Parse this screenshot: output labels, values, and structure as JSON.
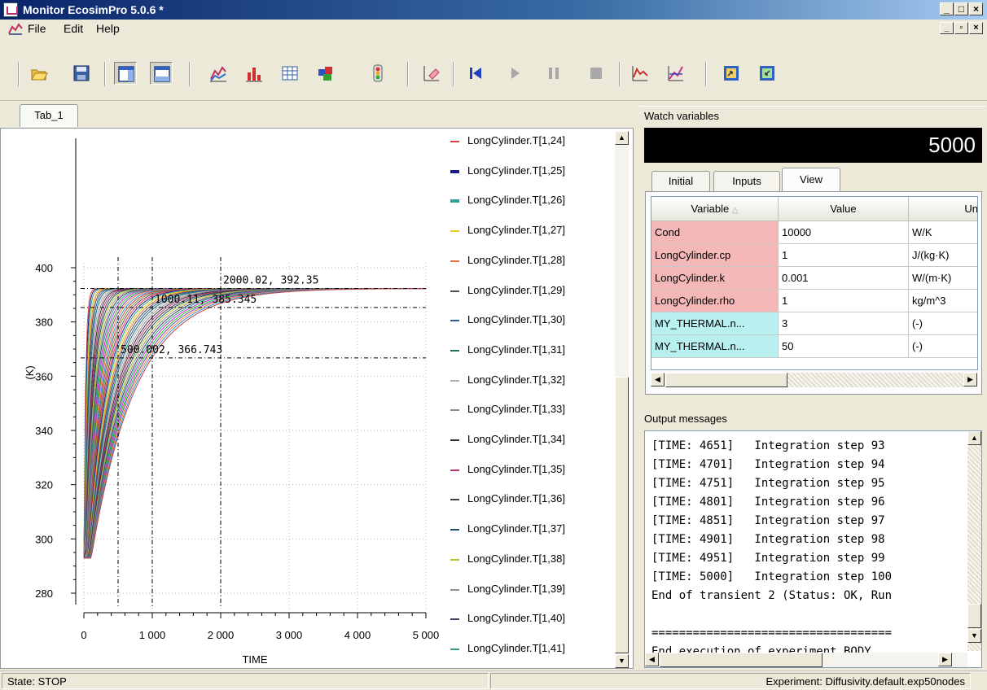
{
  "window": {
    "title": "Monitor EcosimPro 5.0.6 *"
  },
  "menu": {
    "items": [
      "File",
      "Edit",
      "Help"
    ]
  },
  "toolbar": {
    "buttons": [
      "open-folder",
      "save",
      "layout-vertical",
      "layout-horizontal",
      "line-plot",
      "bar-chart",
      "table-view",
      "color-tool",
      "traffic-light",
      "clear-plot",
      "go-to-start",
      "play",
      "pause",
      "stop",
      "plot-options",
      "plot-edit",
      "export-1",
      "export-2"
    ]
  },
  "plot": {
    "tab_label": "Tab_1",
    "y_axis_label": "(K)",
    "x_axis_label": "TIME",
    "y_ticks": [
      "400",
      "380",
      "360",
      "340",
      "320",
      "300",
      "280"
    ],
    "x_ticks": [
      "0",
      "1 000",
      "2 000",
      "3 000",
      "4 000",
      "5 000"
    ],
    "annotations": [
      "2000.02, 392.35",
      "1000.11, 385.345",
      "500.002, 366.743"
    ],
    "legend": [
      {
        "label": "LongCylinder.T[1,24]",
        "color": "#e04040"
      },
      {
        "label": "LongCylinder.T[1,25]",
        "color": "#1a1a8c"
      },
      {
        "label": "LongCylinder.T[1,26]",
        "color": "#2aa198"
      },
      {
        "label": "LongCylinder.T[1,27]",
        "color": "#e6d21e"
      },
      {
        "label": "LongCylinder.T[1,28]",
        "color": "#e8703a"
      },
      {
        "label": "LongCylinder.T[1,29]",
        "color": "#505050"
      },
      {
        "label": "LongCylinder.T[1,30]",
        "color": "#2060a0"
      },
      {
        "label": "LongCylinder.T[1,31]",
        "color": "#207060"
      },
      {
        "label": "LongCylinder.T[1,32]",
        "color": "#b0b0b0"
      },
      {
        "label": "LongCylinder.T[1,33]",
        "color": "#a080a0"
      },
      {
        "label": "LongCylinder.T[1,34]",
        "color": "#303030"
      },
      {
        "label": "LongCylinder.T[1,35]",
        "color": "#c0307a"
      },
      {
        "label": "LongCylinder.T[1,36]",
        "color": "#404040"
      },
      {
        "label": "LongCylinder.T[1,37]",
        "color": "#205070"
      },
      {
        "label": "LongCylinder.T[1,38]",
        "color": "#c0c020"
      },
      {
        "label": "LongCylinder.T[1,39]",
        "color": "#909090"
      },
      {
        "label": "LongCylinder.T[1,40]",
        "color": "#404060"
      },
      {
        "label": "LongCylinder.T[1,41]",
        "color": "#30a090"
      }
    ]
  },
  "chart_data": {
    "type": "line",
    "xlabel": "TIME",
    "ylabel": "(K)",
    "xlim": [
      0,
      5000
    ],
    "ylim": [
      280,
      400
    ],
    "annotations": [
      {
        "x": 2000.02,
        "y": 392.35,
        "text": "2000.02, 392.35"
      },
      {
        "x": 1000.11,
        "y": 385.345,
        "text": "1000.11, 385.345"
      },
      {
        "x": 500.002,
        "y": 366.743,
        "text": "500.002, 366.743"
      }
    ],
    "series_visible_in_legend": [
      "LongCylinder.T[1,24]",
      "LongCylinder.T[1,25]",
      "LongCylinder.T[1,26]",
      "LongCylinder.T[1,27]",
      "LongCylinder.T[1,28]",
      "LongCylinder.T[1,29]",
      "LongCylinder.T[1,30]",
      "LongCylinder.T[1,31]",
      "LongCylinder.T[1,32]",
      "LongCylinder.T[1,33]",
      "LongCylinder.T[1,34]",
      "LongCylinder.T[1,35]",
      "LongCylinder.T[1,36]",
      "LongCylinder.T[1,37]",
      "LongCylinder.T[1,38]",
      "LongCylinder.T[1,39]",
      "LongCylinder.T[1,40]",
      "LongCylinder.T[1,41]"
    ],
    "series_shape": {
      "start_value": 293,
      "final_value": 392.35,
      "final_time": 5000
    }
  },
  "watch": {
    "header": "Watch variables",
    "time_value": "5000",
    "tabs": [
      "Initial",
      "Inputs",
      "View"
    ],
    "columns": [
      "Variable",
      "Value",
      "Un"
    ],
    "rows": [
      {
        "variable": "Cond",
        "value": "10000",
        "unit": "W/K",
        "bg": "#f4b8b8"
      },
      {
        "variable": "LongCylinder.cp",
        "value": "1",
        "unit": "J/(kg·K)",
        "bg": "#f4b8b8"
      },
      {
        "variable": "LongCylinder.k",
        "value": "0.001",
        "unit": "W/(m·K)",
        "bg": "#f4b8b8"
      },
      {
        "variable": "LongCylinder.rho",
        "value": "1",
        "unit": "kg/m^3",
        "bg": "#f4b8b8"
      },
      {
        "variable": "MY_THERMAL.n...",
        "value": "3",
        "unit": "(-)",
        "bg": "#b8f0f0"
      },
      {
        "variable": "MY_THERMAL.n...",
        "value": "50",
        "unit": "(-)",
        "bg": "#b8f0f0"
      }
    ]
  },
  "output": {
    "header": "Output messages",
    "lines": [
      "[TIME: 4651]   Integration step 93",
      "[TIME: 4701]   Integration step 94",
      "[TIME: 4751]   Integration step 95",
      "[TIME: 4801]   Integration step 96",
      "[TIME: 4851]   Integration step 97",
      "[TIME: 4901]   Integration step 98",
      "[TIME: 4951]   Integration step 99",
      "[TIME: 5000]   Integration step 100",
      "End of transient 2 (Status: OK, Run",
      "",
      "===================================",
      "End execution of experiment BODY"
    ]
  },
  "status": {
    "state": "State: STOP",
    "experiment": "Experiment: Diffusivity.default.exp50nodes"
  }
}
